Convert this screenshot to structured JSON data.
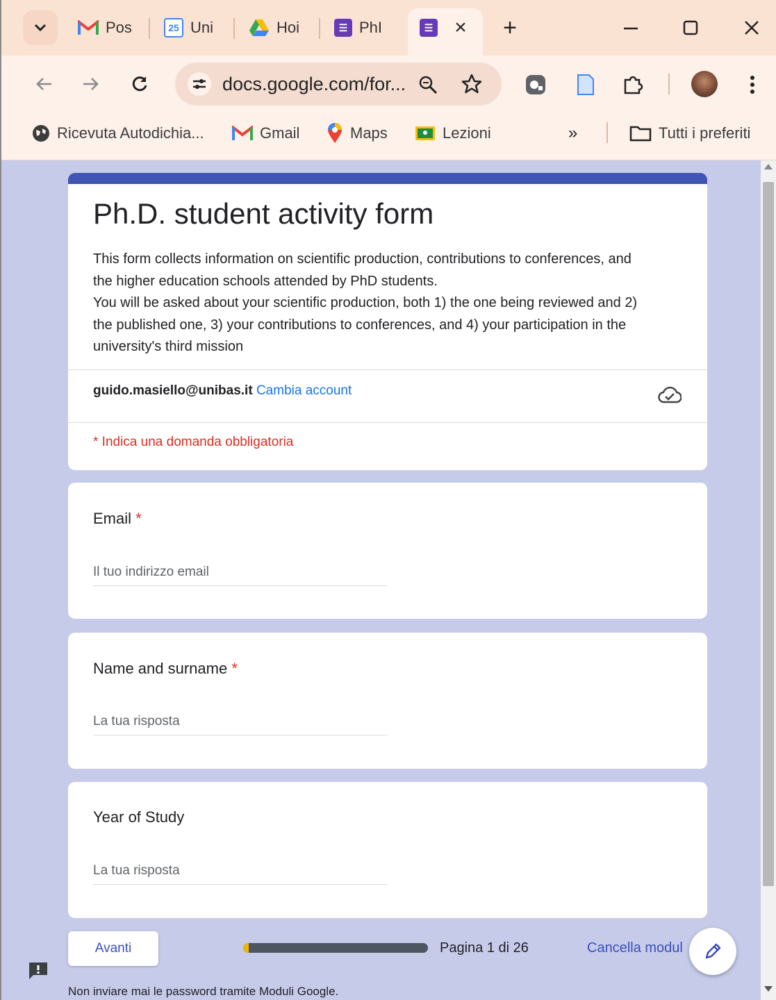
{
  "browser": {
    "tabs": [
      {
        "label": "Pos",
        "icon": "gmail-icon"
      },
      {
        "label": "Uni",
        "icon": "calendar-icon",
        "icon_text": "25"
      },
      {
        "label": "Hoi",
        "icon": "drive-icon"
      },
      {
        "label": "PhI",
        "icon": "forms-icon"
      }
    ],
    "active_tab_close": "×",
    "new_tab": "+",
    "url": "docs.google.com/for...",
    "bookmarks": [
      {
        "label": "Ricevuta Autodichia...",
        "icon": "globe-icon"
      },
      {
        "label": "Gmail",
        "icon": "gmail-icon"
      },
      {
        "label": "Maps",
        "icon": "maps-pin-icon"
      },
      {
        "label": "Lezioni",
        "icon": "classroom-icon"
      }
    ],
    "bookmarks_overflow": "»",
    "all_bookmarks": "Tutti i preferiti"
  },
  "form": {
    "title": "Ph.D. student activity form",
    "description_lines": [
      "This form collects information on scientific production, contributions to conferences, and",
      "the higher education schools attended by PhD students.",
      "You will be asked about your scientific production, both 1) the one being reviewed and 2)",
      "the published one, 3) your contributions to conferences, and 4) your participation in the",
      "university's third mission"
    ],
    "account_email": "guido.masiello@unibas.it",
    "switch_account": "Cambia account",
    "required_note": "* Indica una domanda obbligatoria",
    "questions": [
      {
        "title": "Email",
        "required_mark": "*",
        "placeholder": "Il tuo indirizzo email"
      },
      {
        "title": "Name and surname",
        "required_mark": "*",
        "placeholder": "La tua risposta"
      },
      {
        "title": "Year of Study",
        "required_mark": "",
        "placeholder": "La tua risposta"
      }
    ],
    "next_button": "Avanti",
    "progress": {
      "current": 1,
      "total": 26,
      "text": "Pagina 1 di 26"
    },
    "clear_form": "Cancella modul",
    "footer": "Non inviare mai le password tramite Moduli Google."
  },
  "colors": {
    "header_accent": "#4054b2",
    "page_background": "#c6cbea",
    "required_red": "#d93025",
    "link_blue": "#1a73e8",
    "progress_fill": "#f4b400"
  }
}
